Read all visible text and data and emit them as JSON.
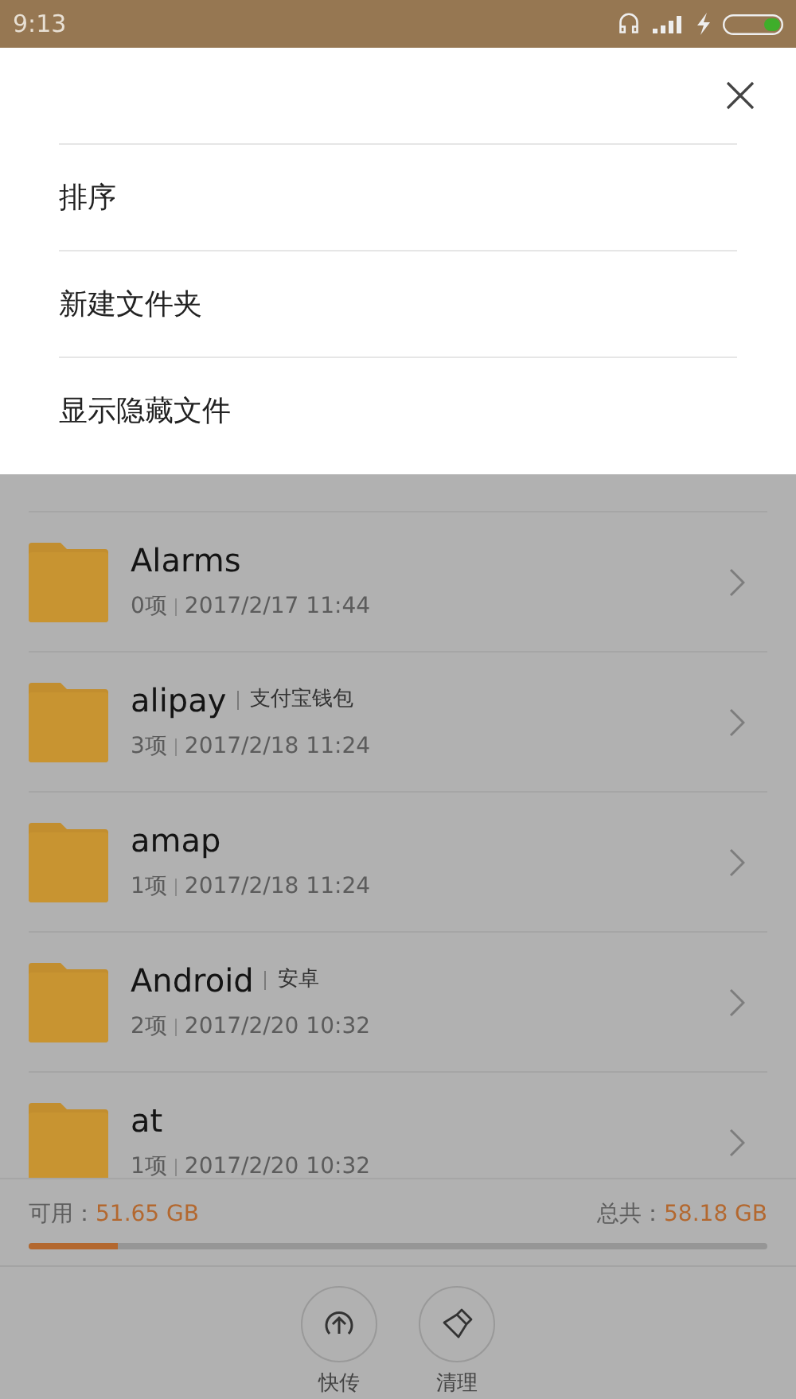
{
  "status_bar": {
    "time": "9:13"
  },
  "menu": {
    "items": [
      {
        "label": "排序"
      },
      {
        "label": "新建文件夹"
      },
      {
        "label": "显示隐藏文件"
      }
    ]
  },
  "files": [
    {
      "name": "Alarms",
      "count": "0项",
      "date": "2017/2/17 11:44"
    },
    {
      "name": "alipay",
      "tag": "支付宝钱包",
      "count": "3项",
      "date": "2017/2/18 11:24"
    },
    {
      "name": "amap",
      "count": "1项",
      "date": "2017/2/18 11:24"
    },
    {
      "name": "Android",
      "tag": "安卓",
      "count": "2项",
      "date": "2017/2/20 10:32"
    },
    {
      "name": "at",
      "count": "1项",
      "date": "2017/2/20 10:32"
    }
  ],
  "storage": {
    "available_label": "可用：",
    "available": "51.65 GB",
    "total_label": "总共：",
    "total": "58.18 GB",
    "level": 0.12
  },
  "actions": [
    {
      "kind": "transfer",
      "label": "快传"
    },
    {
      "kind": "clean",
      "label": "清理"
    }
  ]
}
